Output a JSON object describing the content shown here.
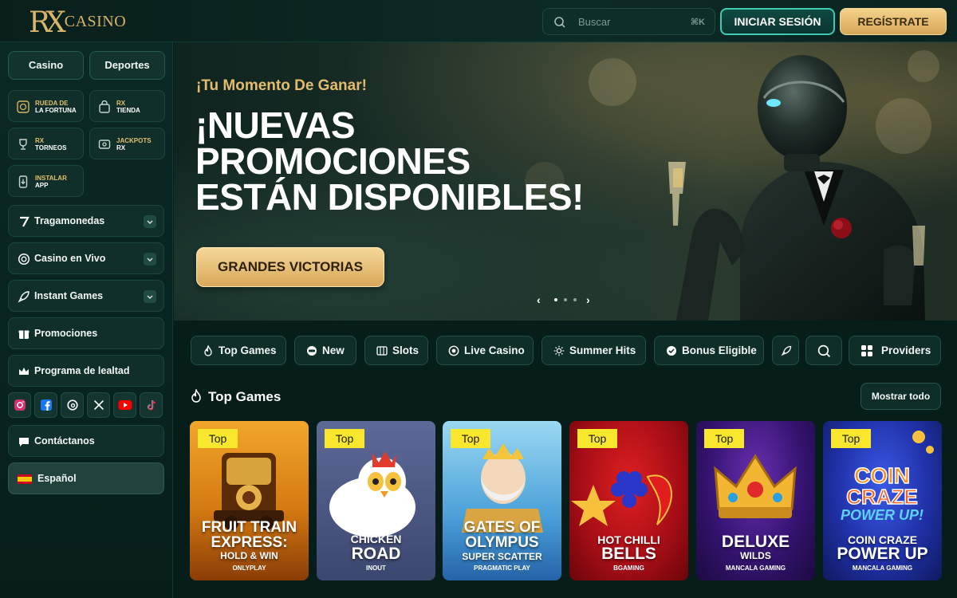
{
  "brand": {
    "logo_mark": "RX",
    "logo_word": "CASINO",
    "gold": "#d9b46a",
    "teal": "#3ec9b0"
  },
  "header": {
    "search_placeholder": "Buscar",
    "search_shortcut": "⌘K",
    "login_label": "INICIAR SESIÓN",
    "register_label": "REGÍSTRATE"
  },
  "sidebar": {
    "tabs": [
      {
        "label": "Casino"
      },
      {
        "label": "Deportes"
      }
    ],
    "tiles": [
      {
        "line1": "RUEDA DE",
        "line2": "LA FORTUNA",
        "icon": "wheel-icon"
      },
      {
        "line1": "RX",
        "line2": "TIENDA",
        "icon": "shopping-bag-icon"
      },
      {
        "line1": "RX",
        "line2": "TORNEOS",
        "icon": "trophy-icon"
      },
      {
        "line1": "JACKPOTS",
        "line2": "RX",
        "icon": "jackpot-icon"
      },
      {
        "line1": "INSTALAR",
        "line2": "APP",
        "icon": "phone-icon"
      }
    ],
    "menu": [
      {
        "label": "Tragamonedas",
        "icon": "seven-icon",
        "expandable": true
      },
      {
        "label": "Casino en Vivo",
        "icon": "chip-icon",
        "expandable": true
      },
      {
        "label": "Instant Games",
        "icon": "rocket-icon",
        "expandable": true
      },
      {
        "label": "Promociones",
        "icon": "gift-icon",
        "expandable": false
      },
      {
        "label": "Programa de lealtad",
        "icon": "crown-icon",
        "expandable": false
      }
    ],
    "socials": [
      "instagram-icon",
      "facebook-icon",
      "threads-icon",
      "x-icon",
      "youtube-icon",
      "tiktok-icon"
    ],
    "contact_label": "Contáctanos",
    "language_label": "Español"
  },
  "hero": {
    "tagline": "¡Tu Momento De Ganar!",
    "title_line1": "¡NUEVAS",
    "title_line2": "PROMOCIONES",
    "title_line3": "ESTÁN DISPONIBLES!",
    "cta_label": "GRANDES VICTORIAS",
    "slide_count": 3,
    "active_slide": 1
  },
  "filters": [
    {
      "label": "Top Games",
      "icon": "flame-icon"
    },
    {
      "label": "New",
      "icon": "new-icon"
    },
    {
      "label": "Slots",
      "icon": "slots-icon"
    },
    {
      "label": "Live Casino",
      "icon": "chip-icon"
    },
    {
      "label": "Summer Hits",
      "icon": "sun-icon"
    },
    {
      "label": "Bonus Eligible",
      "icon": "bonus-icon"
    },
    {
      "label": "",
      "icon": "rocket-icon"
    },
    {
      "label": "",
      "icon": "search-icon"
    },
    {
      "label": "Providers",
      "icon": "grid-icon"
    }
  ],
  "top_games": {
    "title": "Top Games",
    "show_all_label": "Mostrar todo",
    "badge": "Top",
    "games": [
      {
        "line1": "FRUIT TRAIN",
        "line2": "EXPRESS:",
        "line3": "HOLD & WIN",
        "provider": "ONLYPLAY",
        "color": "#c86a12"
      },
      {
        "line1": "CHICKEN",
        "line2": "ROAD",
        "line3": "",
        "provider": "INOUT",
        "color": "#4a5a8a"
      },
      {
        "line1": "GATES OF",
        "line2": "OLYMPUS",
        "line3": "SUPER SCATTER",
        "provider": "PRAGMATIC PLAY",
        "color": "#5aa7e0"
      },
      {
        "line1": "HOT CHILLI",
        "line2": "BELLS",
        "line3": "",
        "provider": "BGAMING",
        "color": "#b3141e"
      },
      {
        "line1": "DELUXE",
        "line2": "WILDS",
        "line3": "",
        "provider": "MANCALA GAMING",
        "color": "#3a1a7a"
      },
      {
        "line1": "COIN CRAZE",
        "line2": "POWER UP",
        "line3": "",
        "provider": "MANCALA GAMING",
        "color": "#2a3aa8"
      }
    ]
  }
}
